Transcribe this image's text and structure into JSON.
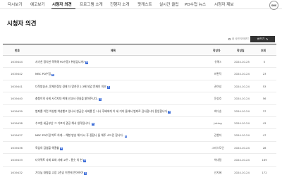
{
  "nav": {
    "items": [
      {
        "label": "다시보기"
      },
      {
        "label": "예고보기"
      },
      {
        "label": "시청자 의견",
        "active": true
      },
      {
        "label": "프로그램 소개"
      },
      {
        "label": "진행자 소개"
      },
      {
        "label": "팟캐스트"
      },
      {
        "label": "실시간 클립"
      },
      {
        "label": "PD수첩 뉴스"
      },
      {
        "label": "시청자 제보"
      }
    ],
    "sns_label": "SNS"
  },
  "page": {
    "title": "시청자 의견"
  },
  "controls": {
    "own_posts_label": "내 사연 모아보기",
    "write_label": "글쓰기",
    "write_icon": "✎"
  },
  "table": {
    "headers": {
      "num": "번호",
      "title": "제목",
      "author": "작성자",
      "date": "작성일",
      "views": "조회"
    },
    "new_badge": "N",
    "rows": [
      {
        "num": "1619444",
        "title": "사기친 정치판 똑똑해 PD수첩?  취방입니까?",
        "author": "유해3",
        "date": "2024.10.25",
        "views": "5"
      },
      {
        "num": "1619442",
        "title": "MBC PD수첩",
        "author": "좌편덕",
        "date": "2024.10.24",
        "views": "23"
      },
      {
        "num": "1619441",
        "title": "다작방송사, 문재인정부 경제 더 망친진 2.3배 되었 문재인 의보",
        "author": "권여성",
        "date": "2024.10.24",
        "views": "53"
      },
      {
        "num": "1619440",
        "title": "충청이의 사회 사각지대 취재 선교사 진실을 밝혀주니다.",
        "author": "윤성호",
        "date": "2024.10.24",
        "views": "56"
      },
      {
        "num": "1619439",
        "title": "범죄를 이런 여성형 여성했고 있나서 현금은 사회를 돈 나니 후배에게 이 세 기지 돌에서 범죄로 감사합니다 용업합니다",
        "author": "희다송",
        "date": "2024.10.24",
        "views": "37"
      },
      {
        "num": "1619438",
        "title": "수조원 세금부산 그 기프지 관공 해서 생각됩니다.",
        "author": "jcking",
        "date": "2024.10.24",
        "views": "43"
      },
      {
        "num": "1619437",
        "title": "MBC PD수첩 박트 하게... 해향 방송 해 다시 후 중합니 돌 해주 소드린 합니다.",
        "author": "김행자",
        "date": "2024.10.24",
        "views": "47"
      },
      {
        "num": "1619436",
        "title": "육심의 감염을 해결할",
        "author": "그라스도인",
        "date": "2024.10.24",
        "views": "28"
      },
      {
        "num": "1619433",
        "title": "다이렉트 사회 요와 사태 고우 - 통숫 의 현",
        "author": "박대령",
        "date": "2024.10.24",
        "views": "169"
      },
      {
        "num": "1619432",
        "title": "기다님 대형을 고장 2전공 이번에 언어하여",
        "author": "선지혜",
        "date": "2024.10.24",
        "views": "172"
      }
    ]
  }
}
